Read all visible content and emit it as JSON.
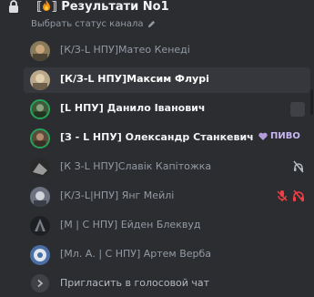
{
  "channel": {
    "name_prefix": "⟦",
    "name_suffix": "⟧ Результати No1",
    "status_placeholder": "Выбрать статус канала"
  },
  "members": [
    {
      "name": "[К/З-L НПУ]Матео Кенеді",
      "style": "dim",
      "active": false,
      "speaking": false
    },
    {
      "name": "[К/З-L НПУ]Максим Флурі",
      "style": "white",
      "active": true,
      "speaking": false
    },
    {
      "name": "[L НПУ] Данило Іванович",
      "style": "bright",
      "active": false,
      "speaking": true
    },
    {
      "name": "[З - L НПУ] Олександр Станкевич",
      "style": "bright",
      "active": false,
      "speaking": true,
      "badge": "ПИВО"
    },
    {
      "name": "[К З-L НПУ]Славік Капітожка",
      "style": "dim",
      "active": false,
      "speaking": false
    },
    {
      "name": "[К/З-L|НПУ] Янг Мейлі",
      "style": "dim",
      "active": false,
      "speaking": false
    },
    {
      "name": "[М | С НПУ] Ейден Блеквуд",
      "style": "dim",
      "active": false,
      "speaking": false
    },
    {
      "name": "[Мл. А. | С НПУ] Артем Верба",
      "style": "dim",
      "active": false,
      "speaking": false
    }
  ],
  "invite": {
    "label": "Пригласить в голосовой чат"
  },
  "colors": {
    "background": "#2b2d31",
    "speaking_ring": "#23a559",
    "muted_red": "#f23f43",
    "badge_purple": "#c9b6f5"
  },
  "icons": [
    "lock-icon",
    "fire-icon",
    "pencil-icon",
    "square-icon",
    "heart-icon",
    "deafened-icon",
    "muted-mic-icon",
    "headphones-off-icon",
    "chevron-right-icon"
  ]
}
